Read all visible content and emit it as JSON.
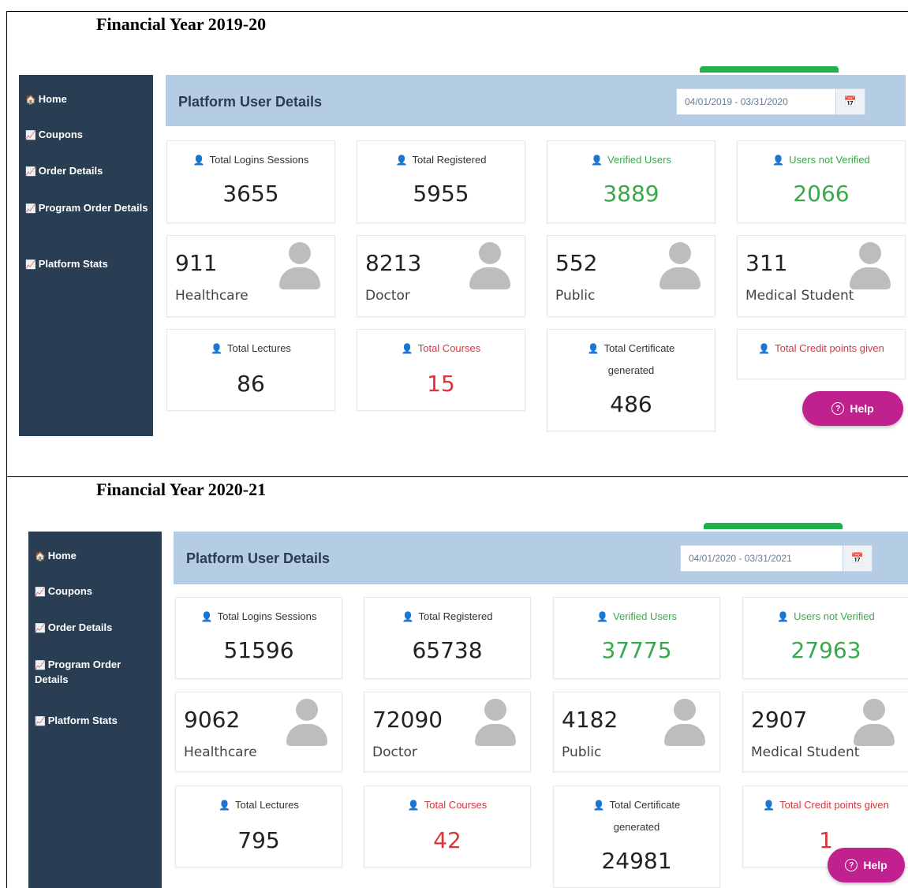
{
  "panels": [
    {
      "year_heading": "Financial Year 2019-20",
      "sidebar": [
        {
          "icon": "home-icon",
          "glyph": "🏠",
          "label": "Home"
        },
        {
          "icon": "chart-icon",
          "glyph": "📈",
          "label": "Coupons"
        },
        {
          "icon": "chart-icon",
          "glyph": "📈",
          "label": "Order Details"
        },
        {
          "icon": "chart-icon",
          "glyph": "📈",
          "label": "Program Order Details"
        },
        {
          "icon": "chart-icon",
          "glyph": "📈",
          "label": "Platform Stats"
        }
      ],
      "header_title": "Platform User Details",
      "date_range": "04/01/2019 - 03/31/2020",
      "stats_top": [
        {
          "label": "Total Logins Sessions",
          "value": "3655",
          "color": "default"
        },
        {
          "label": "Total Registered",
          "value": "5955",
          "color": "default"
        },
        {
          "label": "Verified Users",
          "value": "3889",
          "color": "green"
        },
        {
          "label": "Users not Verified",
          "value": "2066",
          "color": "green"
        }
      ],
      "roles": [
        {
          "value": "911",
          "label": "Healthcare"
        },
        {
          "value": "8213",
          "label": "Doctor"
        },
        {
          "value": "552",
          "label": "Public"
        },
        {
          "value": "311",
          "label": "Medical Student"
        }
      ],
      "stats_bottom": [
        {
          "label": "Total Lectures",
          "value": "86",
          "color": "default"
        },
        {
          "label": "Total Courses",
          "value": "15",
          "color": "red"
        },
        {
          "label": "Total Certificate generated",
          "value": "486",
          "color": "default"
        },
        {
          "label": "Total Credit points given",
          "value": "",
          "color": "red"
        }
      ],
      "help_label": "Help"
    },
    {
      "year_heading": "Financial Year 2020-21",
      "sidebar": [
        {
          "icon": "home-icon",
          "glyph": "🏠",
          "label": "Home"
        },
        {
          "icon": "chart-icon",
          "glyph": "📈",
          "label": "Coupons"
        },
        {
          "icon": "chart-icon",
          "glyph": "📈",
          "label": "Order Details"
        },
        {
          "icon": "chart-icon",
          "glyph": "📈",
          "label": "Program Order Details"
        },
        {
          "icon": "chart-icon",
          "glyph": "📈",
          "label": "Platform Stats"
        }
      ],
      "header_title": "Platform User Details",
      "date_range": "04/01/2020 - 03/31/2021",
      "stats_top": [
        {
          "label": "Total Logins Sessions",
          "value": "51596",
          "color": "default"
        },
        {
          "label": "Total Registered",
          "value": "65738",
          "color": "default"
        },
        {
          "label": "Verified Users",
          "value": "37775",
          "color": "green"
        },
        {
          "label": "Users not Verified",
          "value": "27963",
          "color": "green"
        }
      ],
      "roles": [
        {
          "value": "9062",
          "label": "Healthcare"
        },
        {
          "value": "72090",
          "label": "Doctor"
        },
        {
          "value": "4182",
          "label": "Public"
        },
        {
          "value": "2907",
          "label": "Medical Student"
        }
      ],
      "stats_bottom": [
        {
          "label": "Total Lectures",
          "value": "795",
          "color": "default"
        },
        {
          "label": "Total Courses",
          "value": "42",
          "color": "red"
        },
        {
          "label": "Total Certificate generated",
          "value": "24981",
          "color": "default"
        },
        {
          "label": "Total Credit points given",
          "value": "1",
          "color": "red"
        }
      ],
      "help_label": "Help"
    }
  ]
}
